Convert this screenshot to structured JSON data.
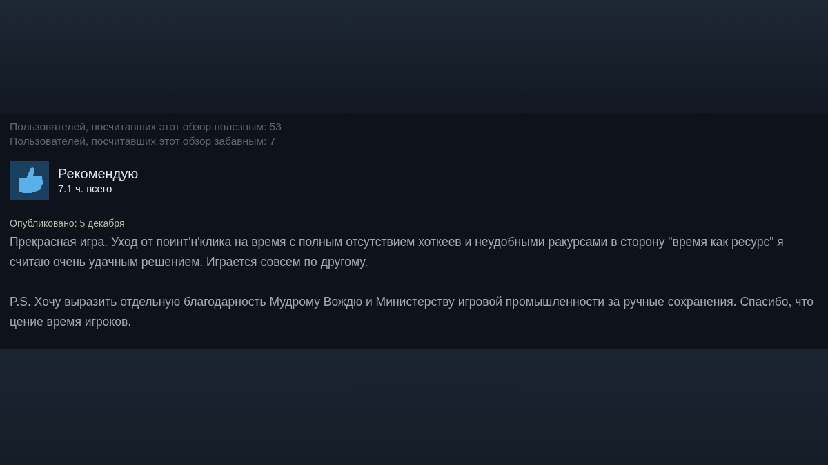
{
  "votes": [
    "Пользователей, посчитавших этот обзор полезным: 53",
    "Пользователей, посчитавших этот обзор забавным: 7"
  ],
  "verdict": {
    "kind": "recommended",
    "title": "Рекомендую",
    "hours": "7.1 ч. всего"
  },
  "posted": "Опубликовано: 5 декабря",
  "review_paragraphs": [
    "Прекрасная игра. Уход от поинт'н'клика на время с полным отсутствием хоткеев и неудобными ракурсами в сторону \"время как ресурс\" я считаю очень удачным решением. Играется совсем по другому.",
    "P.S. Хочу выразить отдельную благодарность Мудрому Вождю и Министерству игровой промышленности за ручные сохранения. Спасибо, что цение время игроков."
  ]
}
